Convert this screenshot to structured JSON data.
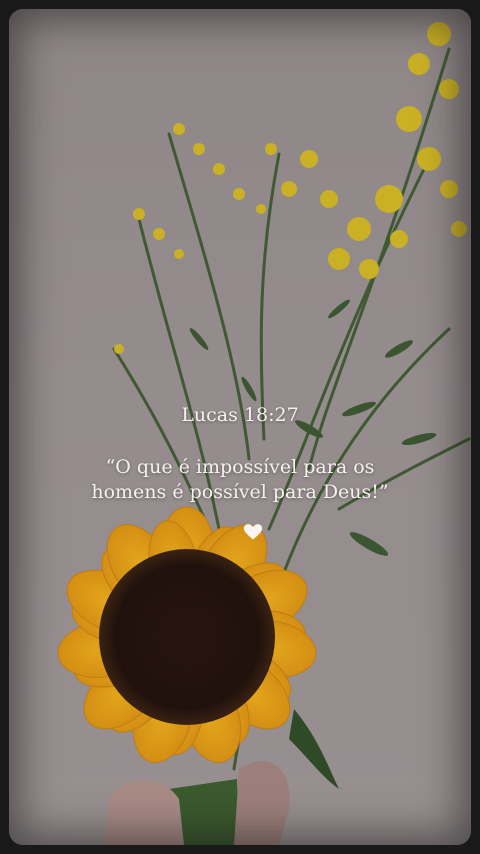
{
  "post": {
    "reference": "Lucas 18:27",
    "quote_line_1": "“O que é impossível para os",
    "quote_line_2": "homens é possível para Deus!”",
    "heart_icon": "heart-icon",
    "text_color": "#f4f1ee"
  }
}
